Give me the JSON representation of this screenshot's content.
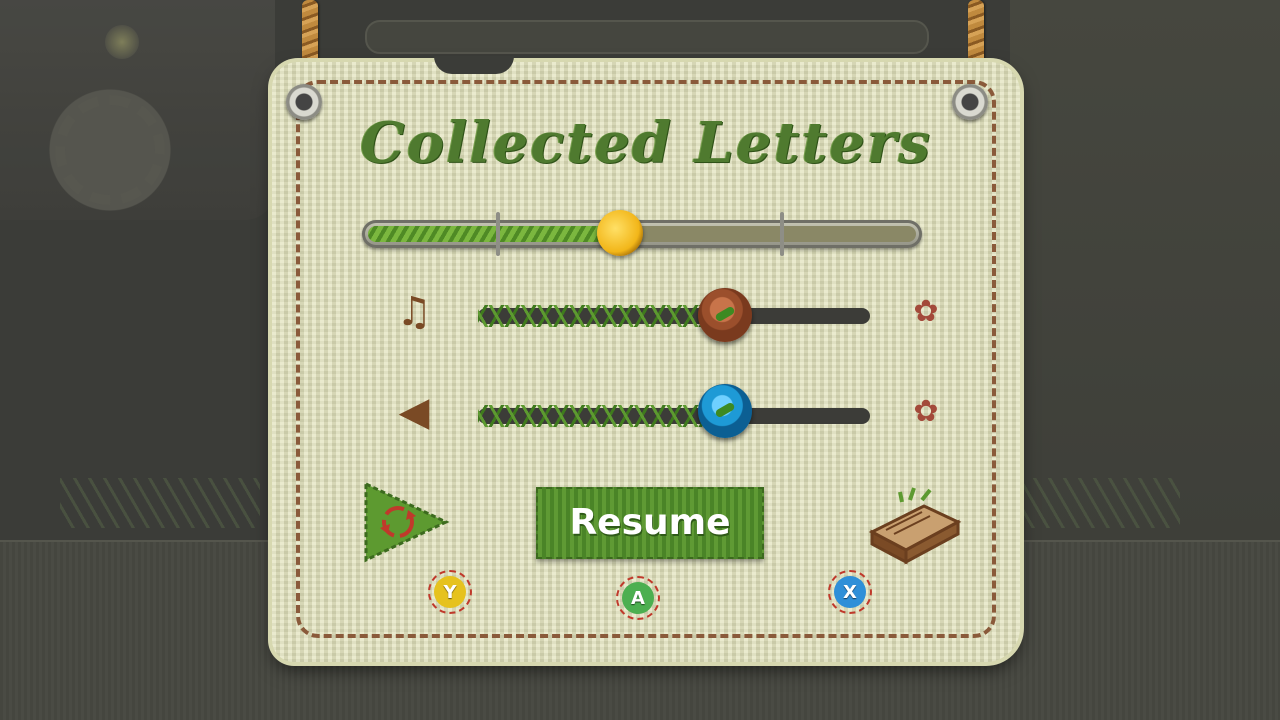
{
  "title": "Collected Letters",
  "progress": {
    "fraction": 0.46,
    "knob_color": "#f2b619",
    "fill_color": "#5d9a30"
  },
  "music": {
    "icon": "music-note-icon",
    "glyph": "♫",
    "level": 0.63,
    "mute_glyph": "✿"
  },
  "sound": {
    "icon": "speaker-icon",
    "glyph": "◀",
    "level": 0.63,
    "mute_glyph": "✿"
  },
  "buttons": {
    "restart_icon": "restart-icon",
    "resume_label": "Resume",
    "book_icon": "book-icon"
  },
  "gamepad": {
    "y": {
      "label": "Y",
      "color": "#e6c21e"
    },
    "a": {
      "label": "A",
      "color": "#4caf50"
    },
    "x": {
      "label": "X",
      "color": "#2f8fd8"
    }
  }
}
